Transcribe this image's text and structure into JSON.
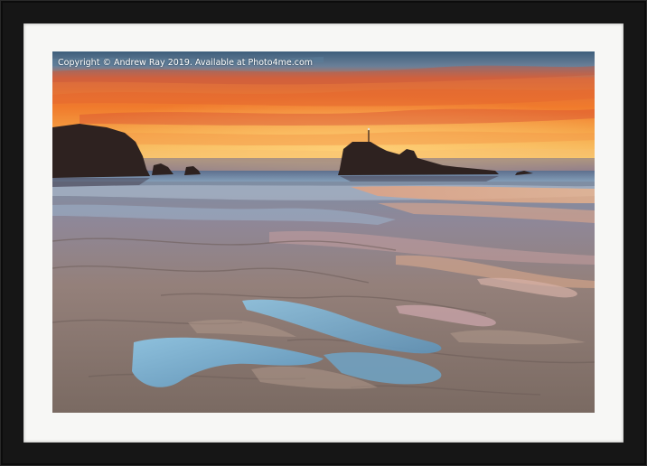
{
  "watermark": {
    "text": "Copyright  © Andrew Ray  2019. Available at Photo4me.com"
  },
  "frame": {
    "frame_color": "#161616",
    "mount_color": "#f7f7f5"
  },
  "scene": {
    "subject": "sunset over tidal beach with sea stacks",
    "palette": {
      "sky_top": "#4a6a86",
      "sky_orange": "#f28a2a",
      "sky_red": "#e0452a",
      "sky_horizon": "#f6c46a",
      "sea": "#7a96b4",
      "sand": "#8a7870",
      "sand_light": "#b09a8c",
      "water_reflection": "#86b8d8",
      "rock": "#3a2a26"
    }
  }
}
